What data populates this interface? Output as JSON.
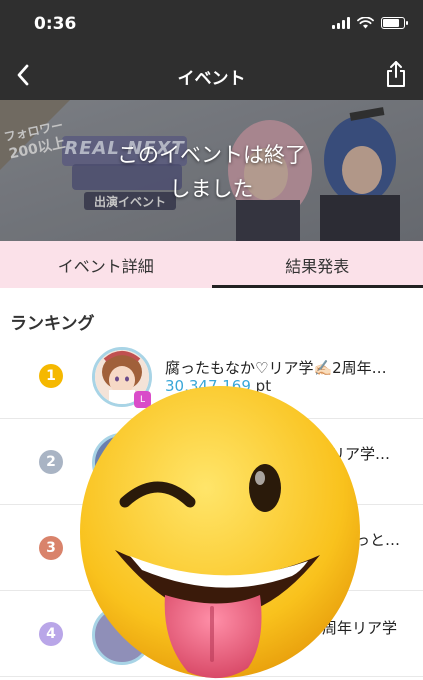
{
  "status": {
    "time": "0:36"
  },
  "nav": {
    "title": "イベント",
    "back_icon": "chevron-left-icon",
    "share_icon": "share-icon"
  },
  "banner": {
    "ended_line1": "このイベントは終了",
    "ended_line2": "しました",
    "follower_line1": "フォロワー",
    "follower_line2": "200以上",
    "logo_text": "REAL NEXT",
    "logo_sub": "出演イベント"
  },
  "tabs": [
    {
      "label": "イベント詳細",
      "active": false
    },
    {
      "label": "結果発表",
      "active": true
    }
  ],
  "ranking": {
    "title": "ランキング",
    "rows": [
      {
        "rank": "1",
        "badge_color": "#f5b800",
        "name": "腐ったもなか♡リア学✍🏻2周年…",
        "points": "30,347,169",
        "unit": "pt"
      },
      {
        "rank": "2",
        "badge_color": "#a9b4c4",
        "name": "リア学…",
        "points": "",
        "unit": ""
      },
      {
        "rank": "3",
        "badge_color": "#d9836b",
        "name": "っと…",
        "points": "",
        "unit": ""
      },
      {
        "rank": "4",
        "badge_color": "#b9a6e8",
        "name": "周年リア学",
        "points": "",
        "unit": ""
      }
    ]
  },
  "colors": {
    "nav_bg": "#2f2f2f",
    "tab_bg": "#fbe1e9",
    "points": "#3aa7d8"
  },
  "sticker": "winking-tongue-emoji"
}
